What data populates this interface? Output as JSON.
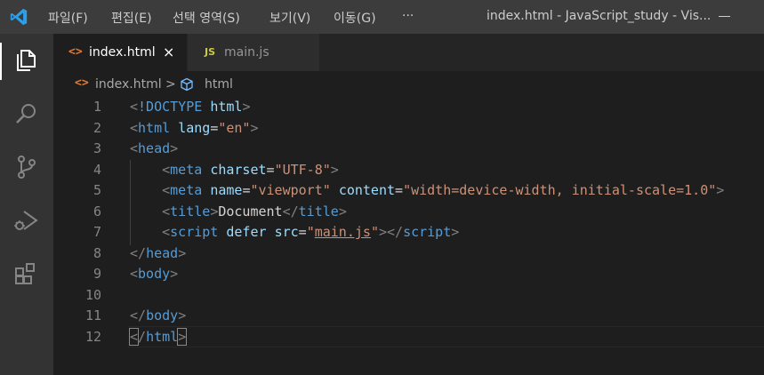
{
  "titlebar": {
    "menus": [
      "파일(F)",
      "편집(E)",
      "선택 영역(S)",
      "보기(V)",
      "이동(G)",
      "···"
    ],
    "window_title": "index.html - JavaScript_study - Vis..."
  },
  "tabs": [
    {
      "icon": "<>",
      "label": "index.html",
      "close": "×"
    },
    {
      "icon": "JS",
      "label": "main.js"
    }
  ],
  "breadcrumb": {
    "icon": "<>",
    "file": "index.html",
    "sep": ">",
    "symbol": "html"
  },
  "editor": {
    "line_numbers": [
      "1",
      "2",
      "3",
      "4",
      "5",
      "6",
      "7",
      "8",
      "9",
      "10",
      "11",
      "12"
    ],
    "current_line": 12,
    "lines": [
      [
        {
          "k": "br",
          "t": "<"
        },
        {
          "k": "tag",
          "t": "!DOCTYPE"
        },
        {
          "k": "txt",
          "t": " "
        },
        {
          "k": "attr",
          "t": "html"
        },
        {
          "k": "br",
          "t": ">"
        }
      ],
      [
        {
          "k": "br",
          "t": "<"
        },
        {
          "k": "tag",
          "t": "html"
        },
        {
          "k": "txt",
          "t": " "
        },
        {
          "k": "attr",
          "t": "lang"
        },
        {
          "k": "eq",
          "t": "="
        },
        {
          "k": "str",
          "t": "\"en\""
        },
        {
          "k": "br",
          "t": ">"
        }
      ],
      [
        {
          "k": "br",
          "t": "<"
        },
        {
          "k": "tag",
          "t": "head"
        },
        {
          "k": "br",
          "t": ">"
        }
      ],
      [
        {
          "k": "txt",
          "t": "    "
        },
        {
          "k": "br",
          "t": "<"
        },
        {
          "k": "tag",
          "t": "meta"
        },
        {
          "k": "txt",
          "t": " "
        },
        {
          "k": "attr",
          "t": "charset"
        },
        {
          "k": "eq",
          "t": "="
        },
        {
          "k": "str",
          "t": "\"UTF-8\""
        },
        {
          "k": "br",
          "t": ">"
        }
      ],
      [
        {
          "k": "txt",
          "t": "    "
        },
        {
          "k": "br",
          "t": "<"
        },
        {
          "k": "tag",
          "t": "meta"
        },
        {
          "k": "txt",
          "t": " "
        },
        {
          "k": "attr",
          "t": "name"
        },
        {
          "k": "eq",
          "t": "="
        },
        {
          "k": "str",
          "t": "\"viewport\""
        },
        {
          "k": "txt",
          "t": " "
        },
        {
          "k": "attr",
          "t": "content"
        },
        {
          "k": "eq",
          "t": "="
        },
        {
          "k": "str",
          "t": "\"width=device-width, initial-scale=1.0\""
        },
        {
          "k": "br",
          "t": ">"
        }
      ],
      [
        {
          "k": "txt",
          "t": "    "
        },
        {
          "k": "br",
          "t": "<"
        },
        {
          "k": "tag",
          "t": "title"
        },
        {
          "k": "br",
          "t": ">"
        },
        {
          "k": "txt",
          "t": "Document"
        },
        {
          "k": "br",
          "t": "</"
        },
        {
          "k": "tag",
          "t": "title"
        },
        {
          "k": "br",
          "t": ">"
        }
      ],
      [
        {
          "k": "txt",
          "t": "    "
        },
        {
          "k": "br",
          "t": "<"
        },
        {
          "k": "tag",
          "t": "script"
        },
        {
          "k": "txt",
          "t": " "
        },
        {
          "k": "attr",
          "t": "defer"
        },
        {
          "k": "txt",
          "t": " "
        },
        {
          "k": "attr",
          "t": "src"
        },
        {
          "k": "eq",
          "t": "="
        },
        {
          "k": "str",
          "t": "\""
        },
        {
          "k": "strlink",
          "t": "main.js"
        },
        {
          "k": "str",
          "t": "\""
        },
        {
          "k": "br",
          "t": "></"
        },
        {
          "k": "tag",
          "t": "script"
        },
        {
          "k": "br",
          "t": ">"
        }
      ],
      [
        {
          "k": "br",
          "t": "</"
        },
        {
          "k": "tag",
          "t": "head"
        },
        {
          "k": "br",
          "t": ">"
        }
      ],
      [
        {
          "k": "br",
          "t": "<"
        },
        {
          "k": "tag",
          "t": "body"
        },
        {
          "k": "br",
          "t": ">"
        }
      ],
      [],
      [
        {
          "k": "br",
          "t": "</"
        },
        {
          "k": "tag",
          "t": "body"
        },
        {
          "k": "br",
          "t": ">"
        }
      ],
      [
        {
          "k": "brm",
          "t": "<"
        },
        {
          "k": "br",
          "t": "/"
        },
        {
          "k": "tag",
          "t": "html"
        },
        {
          "k": "brm",
          "t": ">"
        }
      ]
    ]
  },
  "colors": {
    "titlebar_bg": "#3c3c3c",
    "activity_bg": "#333333",
    "editor_bg": "#1e1e1e",
    "tag": "#569cd6",
    "attribute": "#9cdcfe",
    "string": "#ce9178",
    "punctuation": "#808080",
    "html_icon": "#e37933",
    "js_icon": "#cbcb41"
  },
  "activity_icons": [
    "explorer-icon",
    "search-icon",
    "source-control-icon",
    "run-debug-icon",
    "extensions-icon"
  ]
}
